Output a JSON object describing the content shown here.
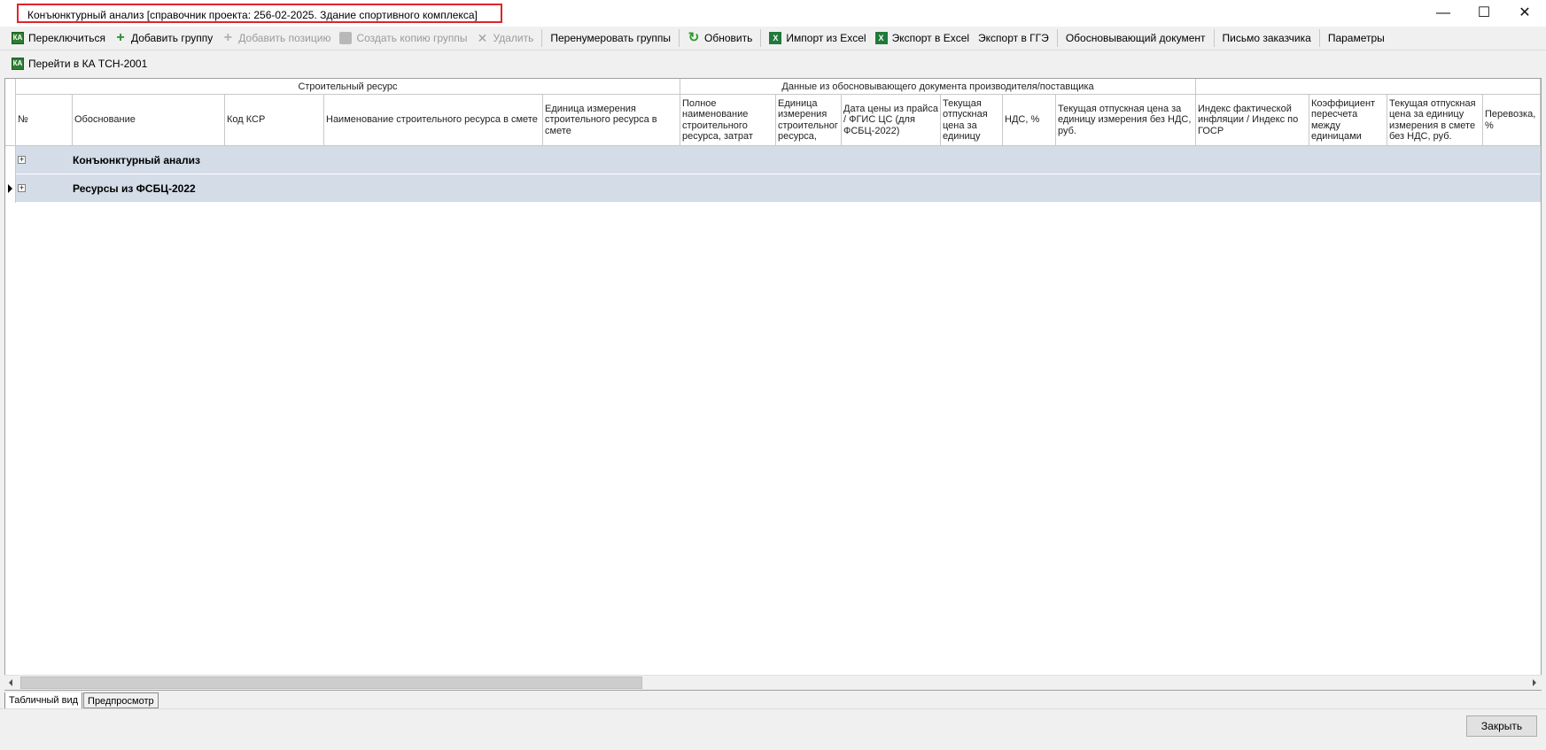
{
  "window": {
    "title": "Конъюнктурный анализ [справочник проекта: 256-02-2025. Здание спортивного комплекса]",
    "minimize": "—",
    "maximize": "☐",
    "close": "✕"
  },
  "toolbar": {
    "switch": "Переключиться",
    "add_group": "Добавить группу",
    "add_position": "Добавить позицию",
    "copy_group": "Создать копию группы",
    "delete": "Удалить",
    "renumber": "Перенумеровать группы",
    "refresh": "Обновить",
    "import_excel": "Импорт из Excel",
    "export_excel": "Экспорт в Excel",
    "export_gge": "Экспорт в ГГЭ",
    "justifying_doc": "Обосновывающий документ",
    "customer_letter": "Письмо заказчика",
    "params": "Параметры",
    "goto_ka": "Перейти в КА ТСН-2001"
  },
  "grid": {
    "bands": {
      "resource": "Строительный ресурс",
      "supplier_data": "Данные из обосновывающего документа производителя/поставщика"
    },
    "columns": {
      "num": "№",
      "basis": "Обоснование",
      "ksr_code": "Код КСР",
      "resource_name": "Наименование строительного ресурса в смете",
      "unit": "Единица измерения строительного ресурса в смете",
      "full_name": "Полное наименование строительного ресурса, затрат",
      "unit2": "Единица измерения строительног ресурса,",
      "price_date": "Дата цены из прайса / ФГИС ЦС (для ФСБЦ-2022)",
      "current_price": "Текущая отпускная цена за единицу",
      "vat": "НДС, %",
      "price_no_vat": "Текущая отпускная цена за единицу измерения без НДС, руб.",
      "inflation_index": "Индекс фактической инфляции / Индекс по ГОСР",
      "conversion_coef": "Коэффициент пересчета между единицами",
      "price_in_estimate": "Текущая отпускная цена за единицу измерения в смете без НДС, руб.",
      "transport": "Перевозка, %"
    },
    "rows": [
      {
        "label": "Конъюнктурный анализ",
        "expander": "+"
      },
      {
        "label": "Ресурсы из ФСБЦ-2022",
        "expander": "+"
      }
    ]
  },
  "tabs": {
    "table_view": "Табличный вид",
    "preview": "Предпросмотр"
  },
  "footer": {
    "close_button": "Закрыть"
  }
}
